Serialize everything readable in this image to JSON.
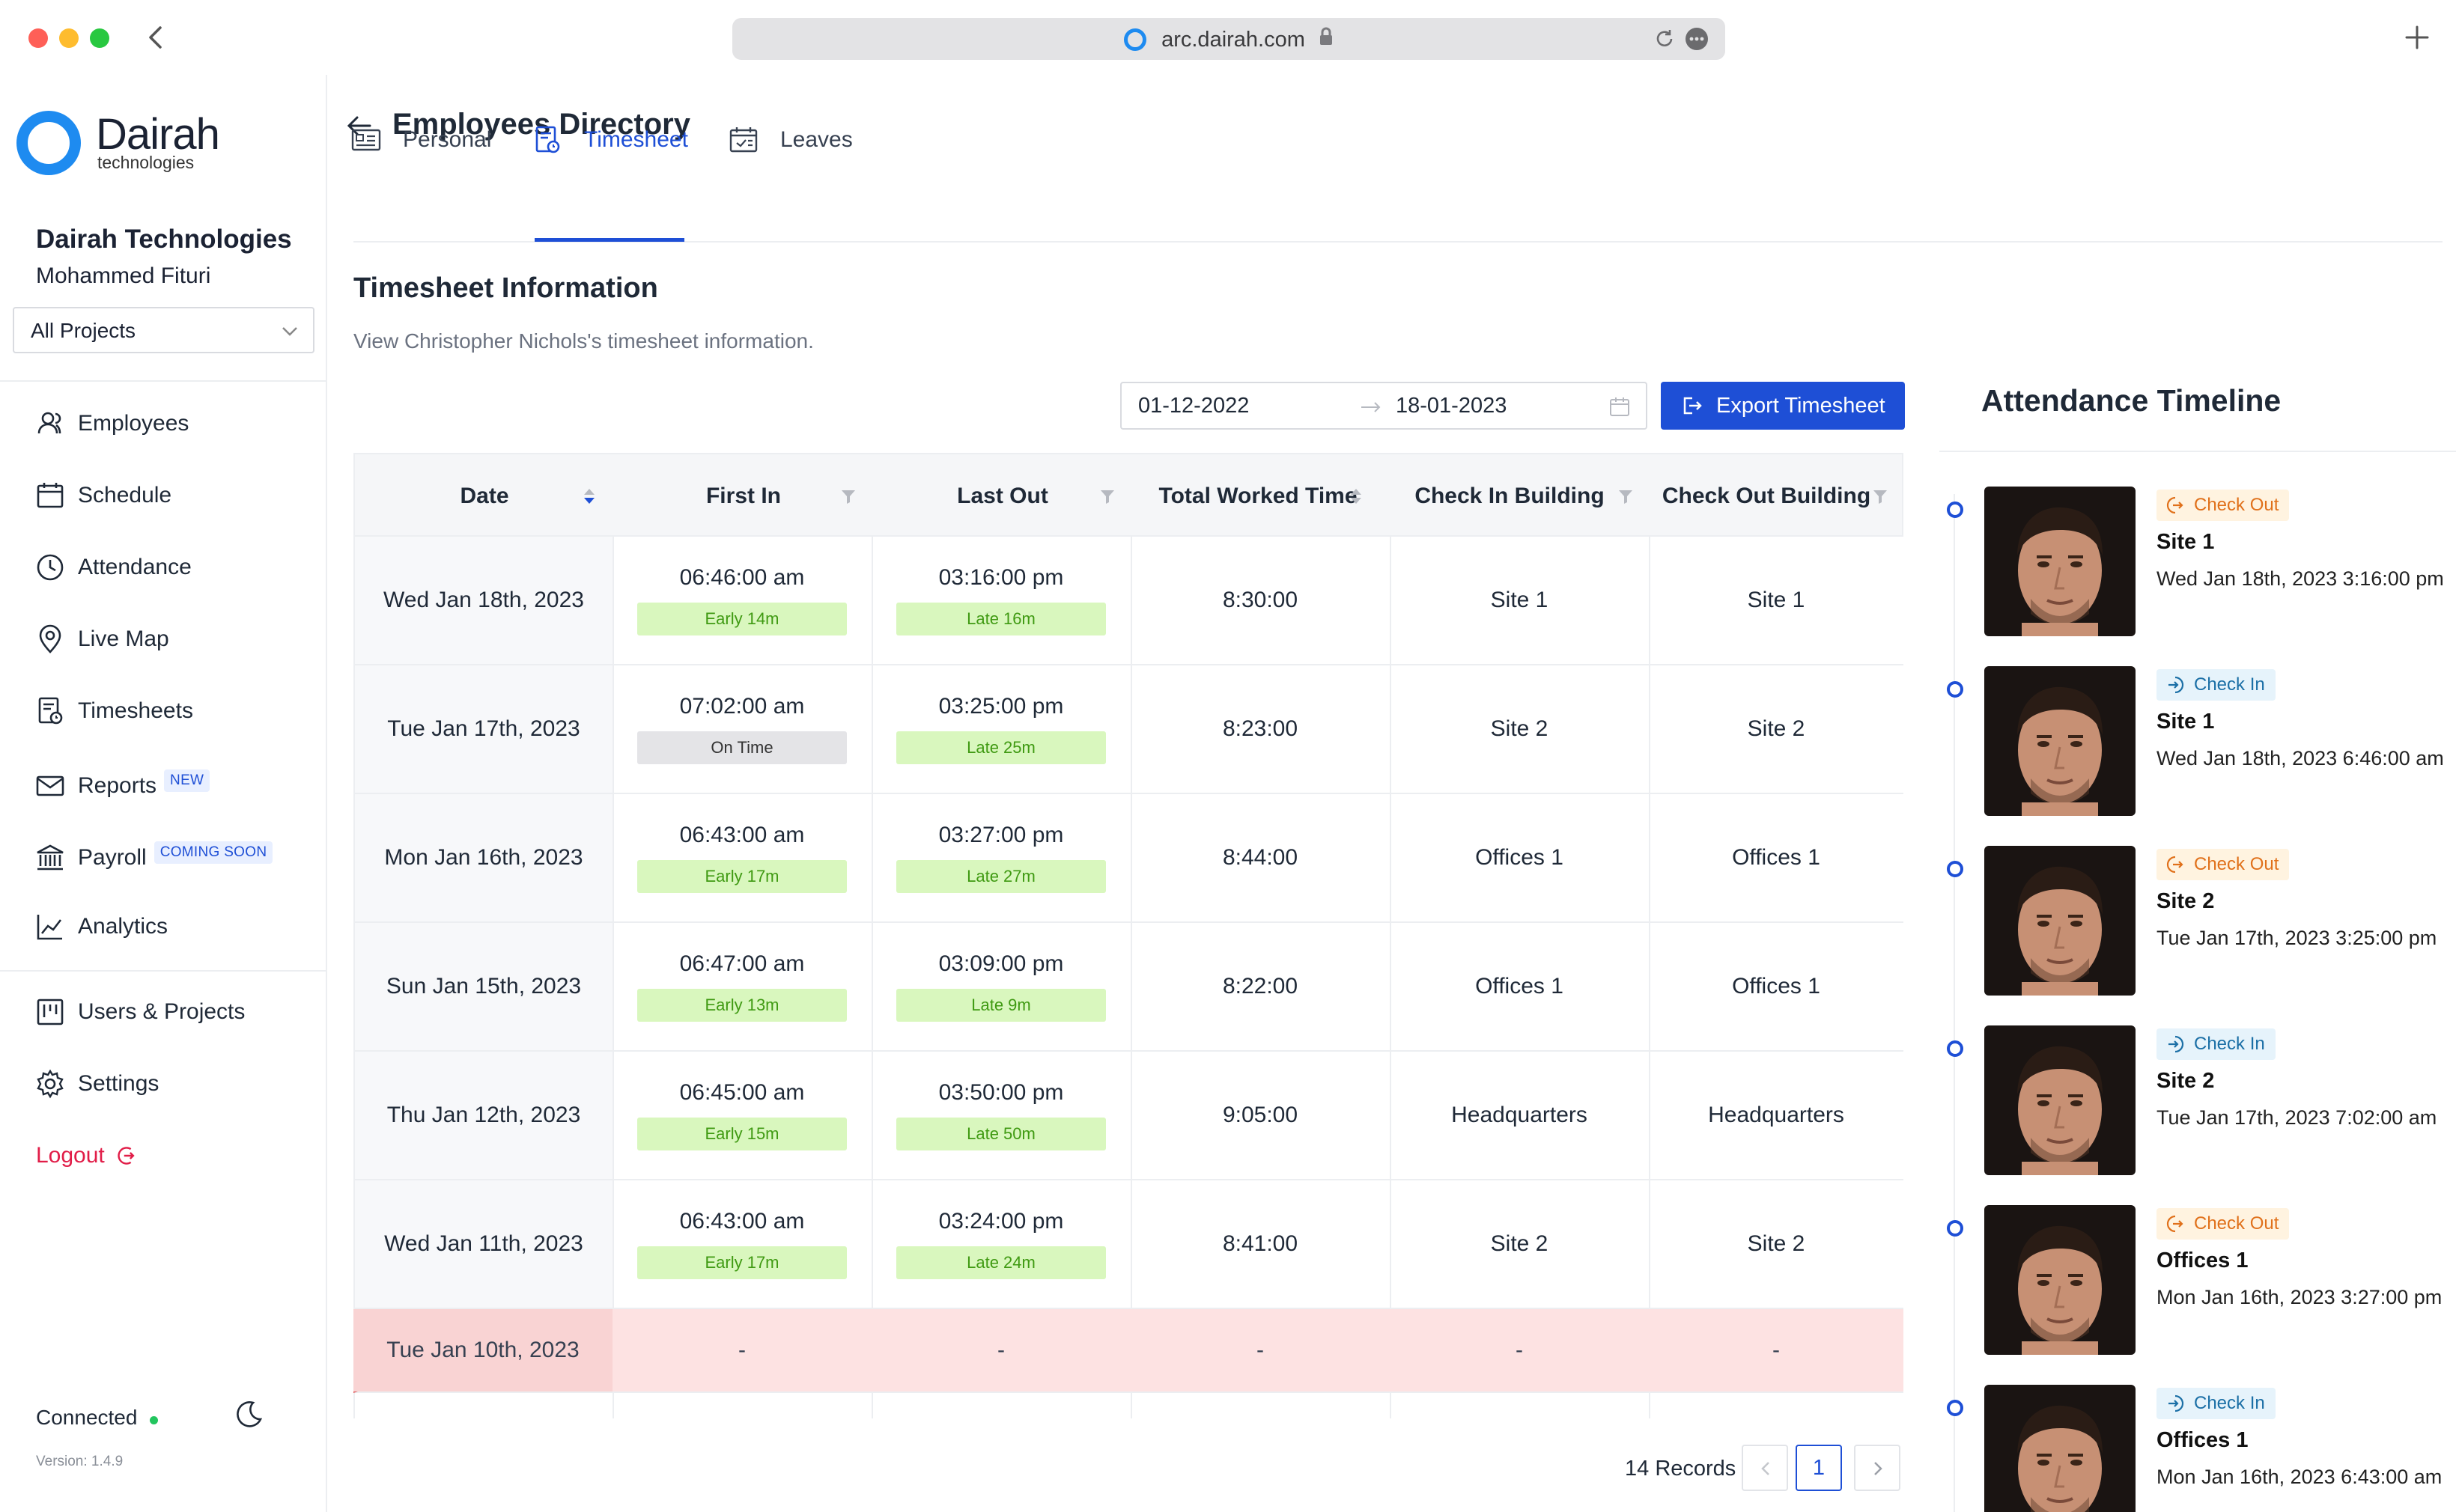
{
  "browser": {
    "url": "arc.dairah.com"
  },
  "brand": {
    "name": "Dairah",
    "tagline": "technologies"
  },
  "org": {
    "company": "Dairah Technologies",
    "user": "Mohammed Fituri",
    "project_select": "All Projects"
  },
  "nav": {
    "employees": "Employees",
    "schedule": "Schedule",
    "attendance": "Attendance",
    "live_map": "Live Map",
    "timesheets": "Timesheets",
    "reports": "Reports",
    "reports_badge": "NEW",
    "payroll": "Payroll",
    "payroll_badge": "COMING SOON",
    "analytics": "Analytics",
    "users_projects": "Users & Projects",
    "settings": "Settings",
    "logout": "Logout"
  },
  "footer": {
    "status": "Connected",
    "version": "Version: 1.4.9",
    "status_color": "#22c55e"
  },
  "page": {
    "title": "Employees Directory"
  },
  "tabs": {
    "personal": "Personal",
    "timesheet": "Timesheet",
    "leaves": "Leaves"
  },
  "section": {
    "title": "Timesheet Information",
    "subtitle": "View Christopher Nichols's timesheet information."
  },
  "filters": {
    "start_date": "01-12-2022",
    "end_date": "18-01-2023",
    "export_label": "Export Timesheet"
  },
  "table": {
    "headers": {
      "date": "Date",
      "first_in": "First In",
      "last_out": "Last Out",
      "total": "Total Worked Time",
      "in_building": "Check In Building",
      "out_building": "Check Out Building"
    },
    "rows": [
      {
        "date": "Wed Jan 18th, 2023",
        "first_in": "06:46:00 am",
        "first_tag": "Early 14m",
        "last_out": "03:16:00 pm",
        "last_tag": "Late 16m",
        "total": "8:30:00",
        "in_b": "Site 1",
        "out_b": "Site 1"
      },
      {
        "date": "Tue Jan 17th, 2023",
        "first_in": "07:02:00 am",
        "first_tag": "On Time",
        "last_out": "03:25:00 pm",
        "last_tag": "Late 25m",
        "total": "8:23:00",
        "in_b": "Site 2",
        "out_b": "Site 2"
      },
      {
        "date": "Mon Jan 16th, 2023",
        "first_in": "06:43:00 am",
        "first_tag": "Early 17m",
        "last_out": "03:27:00 pm",
        "last_tag": "Late 27m",
        "total": "8:44:00",
        "in_b": "Offices 1",
        "out_b": "Offices 1"
      },
      {
        "date": "Sun Jan 15th, 2023",
        "first_in": "06:47:00 am",
        "first_tag": "Early 13m",
        "last_out": "03:09:00 pm",
        "last_tag": "Late 9m",
        "total": "8:22:00",
        "in_b": "Offices 1",
        "out_b": "Offices 1"
      },
      {
        "date": "Thu Jan 12th, 2023",
        "first_in": "06:45:00 am",
        "first_tag": "Early 15m",
        "last_out": "03:50:00 pm",
        "last_tag": "Late 50m",
        "total": "9:05:00",
        "in_b": "Headquarters",
        "out_b": "Headquarters"
      },
      {
        "date": "Wed Jan 11th, 2023",
        "first_in": "06:43:00 am",
        "first_tag": "Early 17m",
        "last_out": "03:24:00 pm",
        "last_tag": "Late 24m",
        "total": "8:41:00",
        "in_b": "Site 2",
        "out_b": "Site 2"
      }
    ],
    "absent_row": {
      "date": "Tue Jan 10th, 2023",
      "dash": "-"
    }
  },
  "pagination": {
    "records": "14 Records",
    "page": "1"
  },
  "timeline": {
    "title": "Attendance Timeline",
    "items": [
      {
        "type": "Check Out",
        "site": "Site 1",
        "time": "Wed Jan 18th, 2023 3:16:00 pm"
      },
      {
        "type": "Check In",
        "site": "Site 1",
        "time": "Wed Jan 18th, 2023 6:46:00 am"
      },
      {
        "type": "Check Out",
        "site": "Site 2",
        "time": "Tue Jan 17th, 2023 3:25:00 pm"
      },
      {
        "type": "Check In",
        "site": "Site 2",
        "time": "Tue Jan 17th, 2023 7:02:00 am"
      },
      {
        "type": "Check Out",
        "site": "Offices 1",
        "time": "Mon Jan 16th, 2023 3:27:00 pm"
      },
      {
        "type": "Check In",
        "site": "Offices 1",
        "time": "Mon Jan 16th, 2023 6:43:00 am"
      }
    ]
  },
  "colors": {
    "accent": "#1e4fd6",
    "logout": "#e11d48",
    "absent_bg": "#fde2e2"
  }
}
